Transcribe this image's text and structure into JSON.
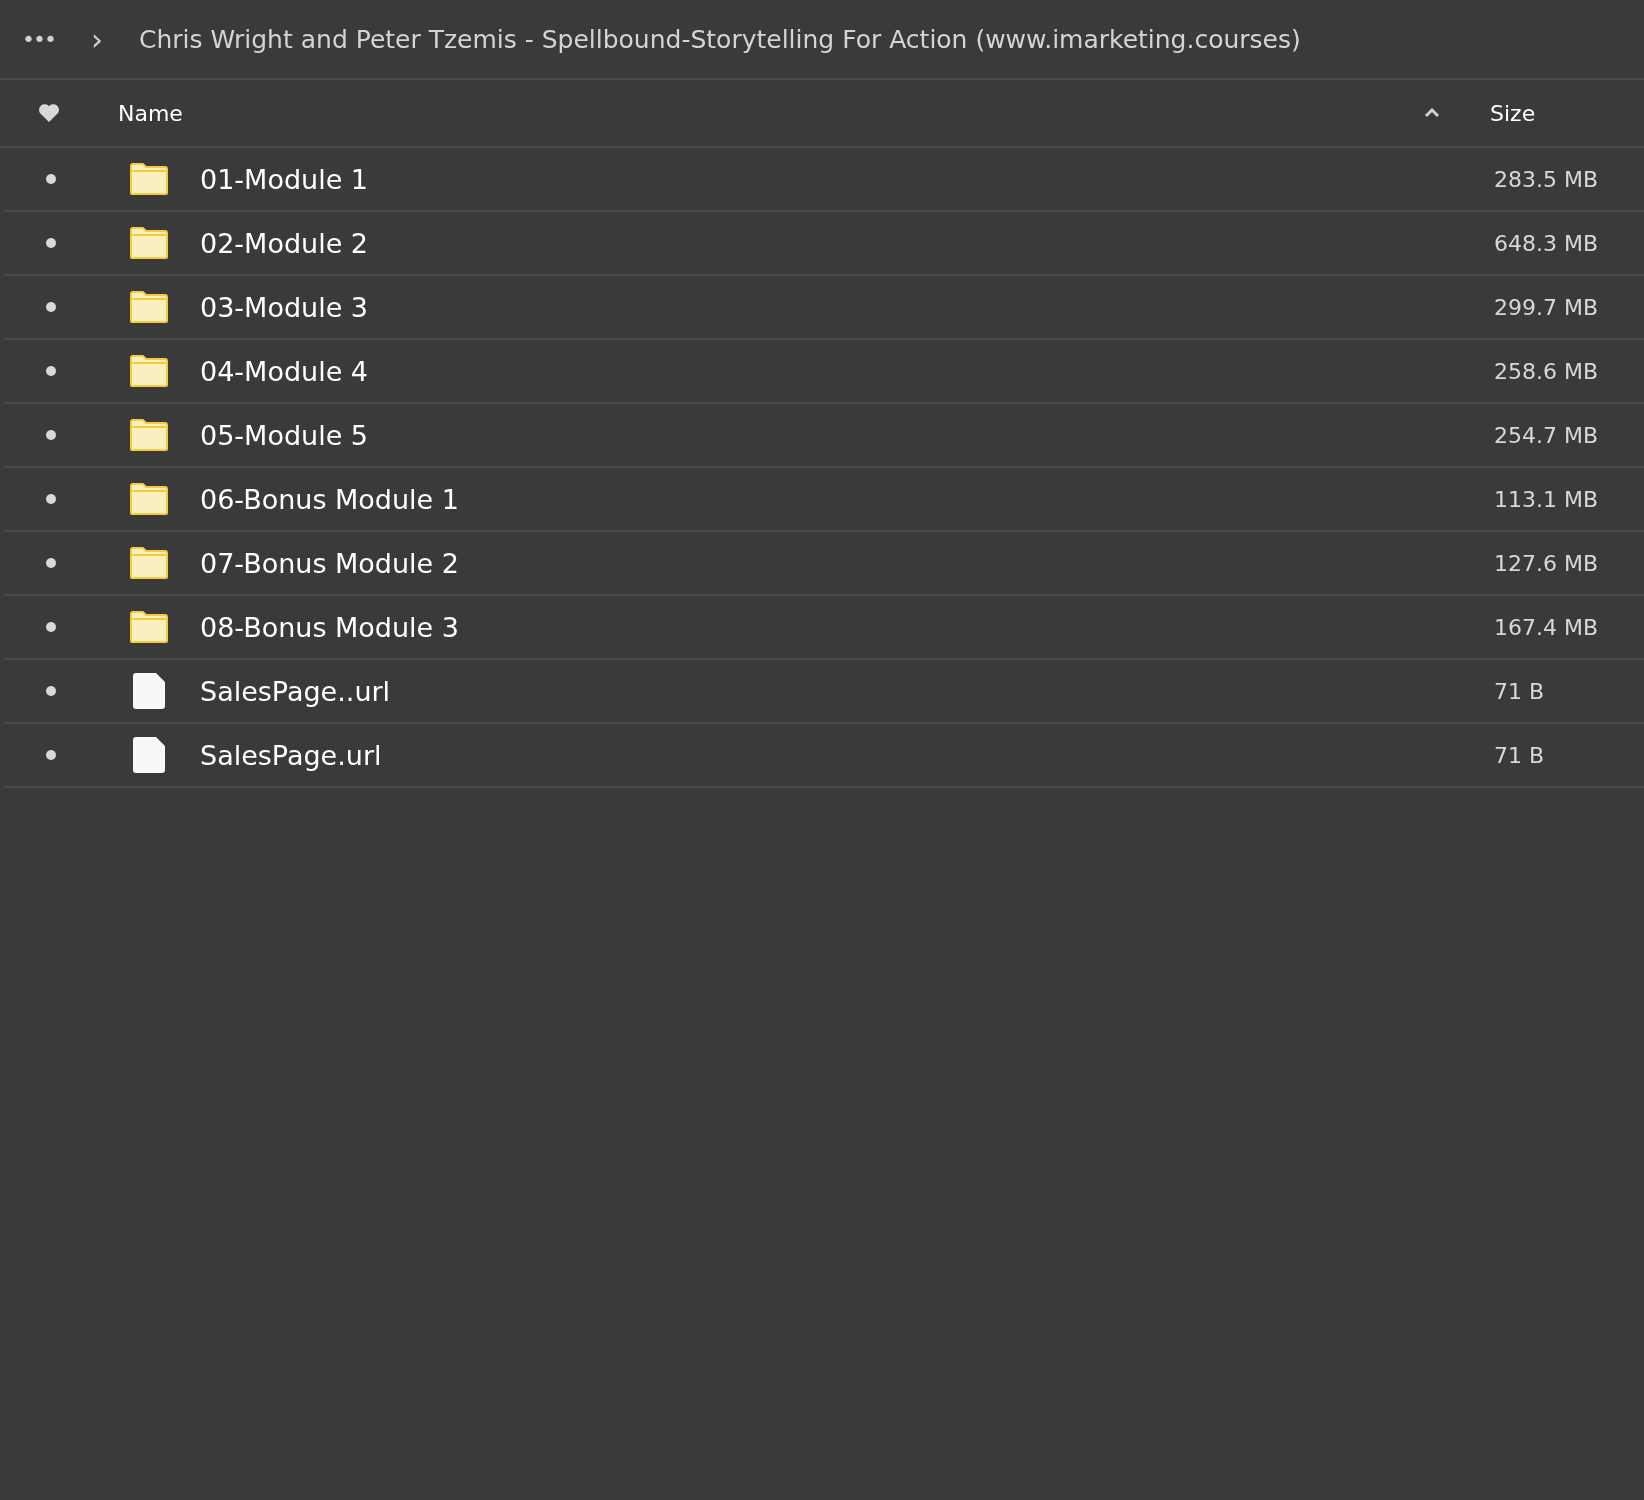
{
  "breadcrumb": {
    "more": "•••",
    "separator": "›",
    "title": "Chris Wright and Peter Tzemis - Spellbound-Storytelling For Action (www.imarketing.courses)"
  },
  "table": {
    "columns": [
      {
        "label": "Name"
      },
      {
        "label": "Size"
      }
    ],
    "rows": [
      {
        "kind": "folder",
        "name": "01-Module 1",
        "size": "283.5 MB"
      },
      {
        "kind": "folder",
        "name": "02-Module 2",
        "size": "648.3 MB"
      },
      {
        "kind": "folder",
        "name": "03-Module 3",
        "size": "299.7 MB"
      },
      {
        "kind": "folder",
        "name": "04-Module 4",
        "size": "258.6 MB"
      },
      {
        "kind": "folder",
        "name": "05-Module 5",
        "size": "254.7 MB"
      },
      {
        "kind": "folder",
        "name": "06-Bonus Module 1",
        "size": "113.1 MB"
      },
      {
        "kind": "folder",
        "name": "07-Bonus Module 2",
        "size": "127.6 MB"
      },
      {
        "kind": "folder",
        "name": "08-Bonus Module 3",
        "size": "167.4 MB"
      },
      {
        "kind": "file",
        "name": "SalesPage..url",
        "size": "71 B"
      },
      {
        "kind": "file",
        "name": "SalesPage.url",
        "size": "71 B"
      }
    ]
  }
}
